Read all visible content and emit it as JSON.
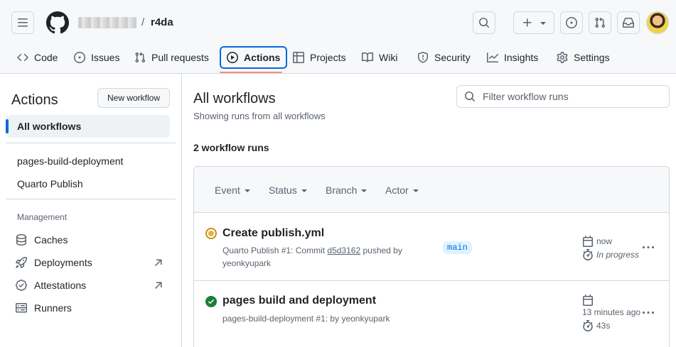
{
  "header": {
    "repo_name": "r4da",
    "separator": "/"
  },
  "tabs": [
    {
      "label": "Code",
      "icon": "code-icon"
    },
    {
      "label": "Issues",
      "icon": "issue-opened-icon"
    },
    {
      "label": "Pull requests",
      "icon": "git-pull-request-icon"
    },
    {
      "label": "Actions",
      "icon": "play-icon",
      "active": true
    },
    {
      "label": "Projects",
      "icon": "table-icon"
    },
    {
      "label": "Wiki",
      "icon": "book-icon"
    },
    {
      "label": "Security",
      "icon": "shield-icon"
    },
    {
      "label": "Insights",
      "icon": "graph-icon"
    },
    {
      "label": "Settings",
      "icon": "gear-icon"
    }
  ],
  "sidebar": {
    "title": "Actions",
    "new_workflow": "New workflow",
    "all_workflows": "All workflows",
    "workflows": [
      "pages-build-deployment",
      "Quarto Publish"
    ],
    "management_heading": "Management",
    "management": [
      {
        "label": "Caches",
        "icon": "database-icon"
      },
      {
        "label": "Deployments",
        "icon": "rocket-icon"
      },
      {
        "label": "Attestations",
        "icon": "verified-icon"
      },
      {
        "label": "Runners",
        "icon": "server-icon"
      }
    ]
  },
  "main": {
    "title": "All workflows",
    "subtitle": "Showing runs from all workflows",
    "filter_placeholder": "Filter workflow runs",
    "run_count": "2 workflow runs",
    "filters": [
      "Event",
      "Status",
      "Branch",
      "Actor"
    ],
    "runs": [
      {
        "title": "Create publish.yml",
        "status": "in-progress",
        "meta_prefix": "Quarto Publish #1: Commit",
        "commit": "d5d3162",
        "meta_suffix": "pushed by",
        "actor": "yeonkyupark",
        "branch": "main",
        "when": "now",
        "duration": "In progress"
      },
      {
        "title": "pages build and deployment",
        "status": "success",
        "meta": "pages-build-deployment #1: by yeonkyupark",
        "when": "13 minutes ago",
        "duration": "43s"
      }
    ]
  },
  "colors": {
    "accent": "#0969da",
    "success": "#1a7f37",
    "in_progress": "#bf8700",
    "tab_underline": "#fd8c73"
  }
}
